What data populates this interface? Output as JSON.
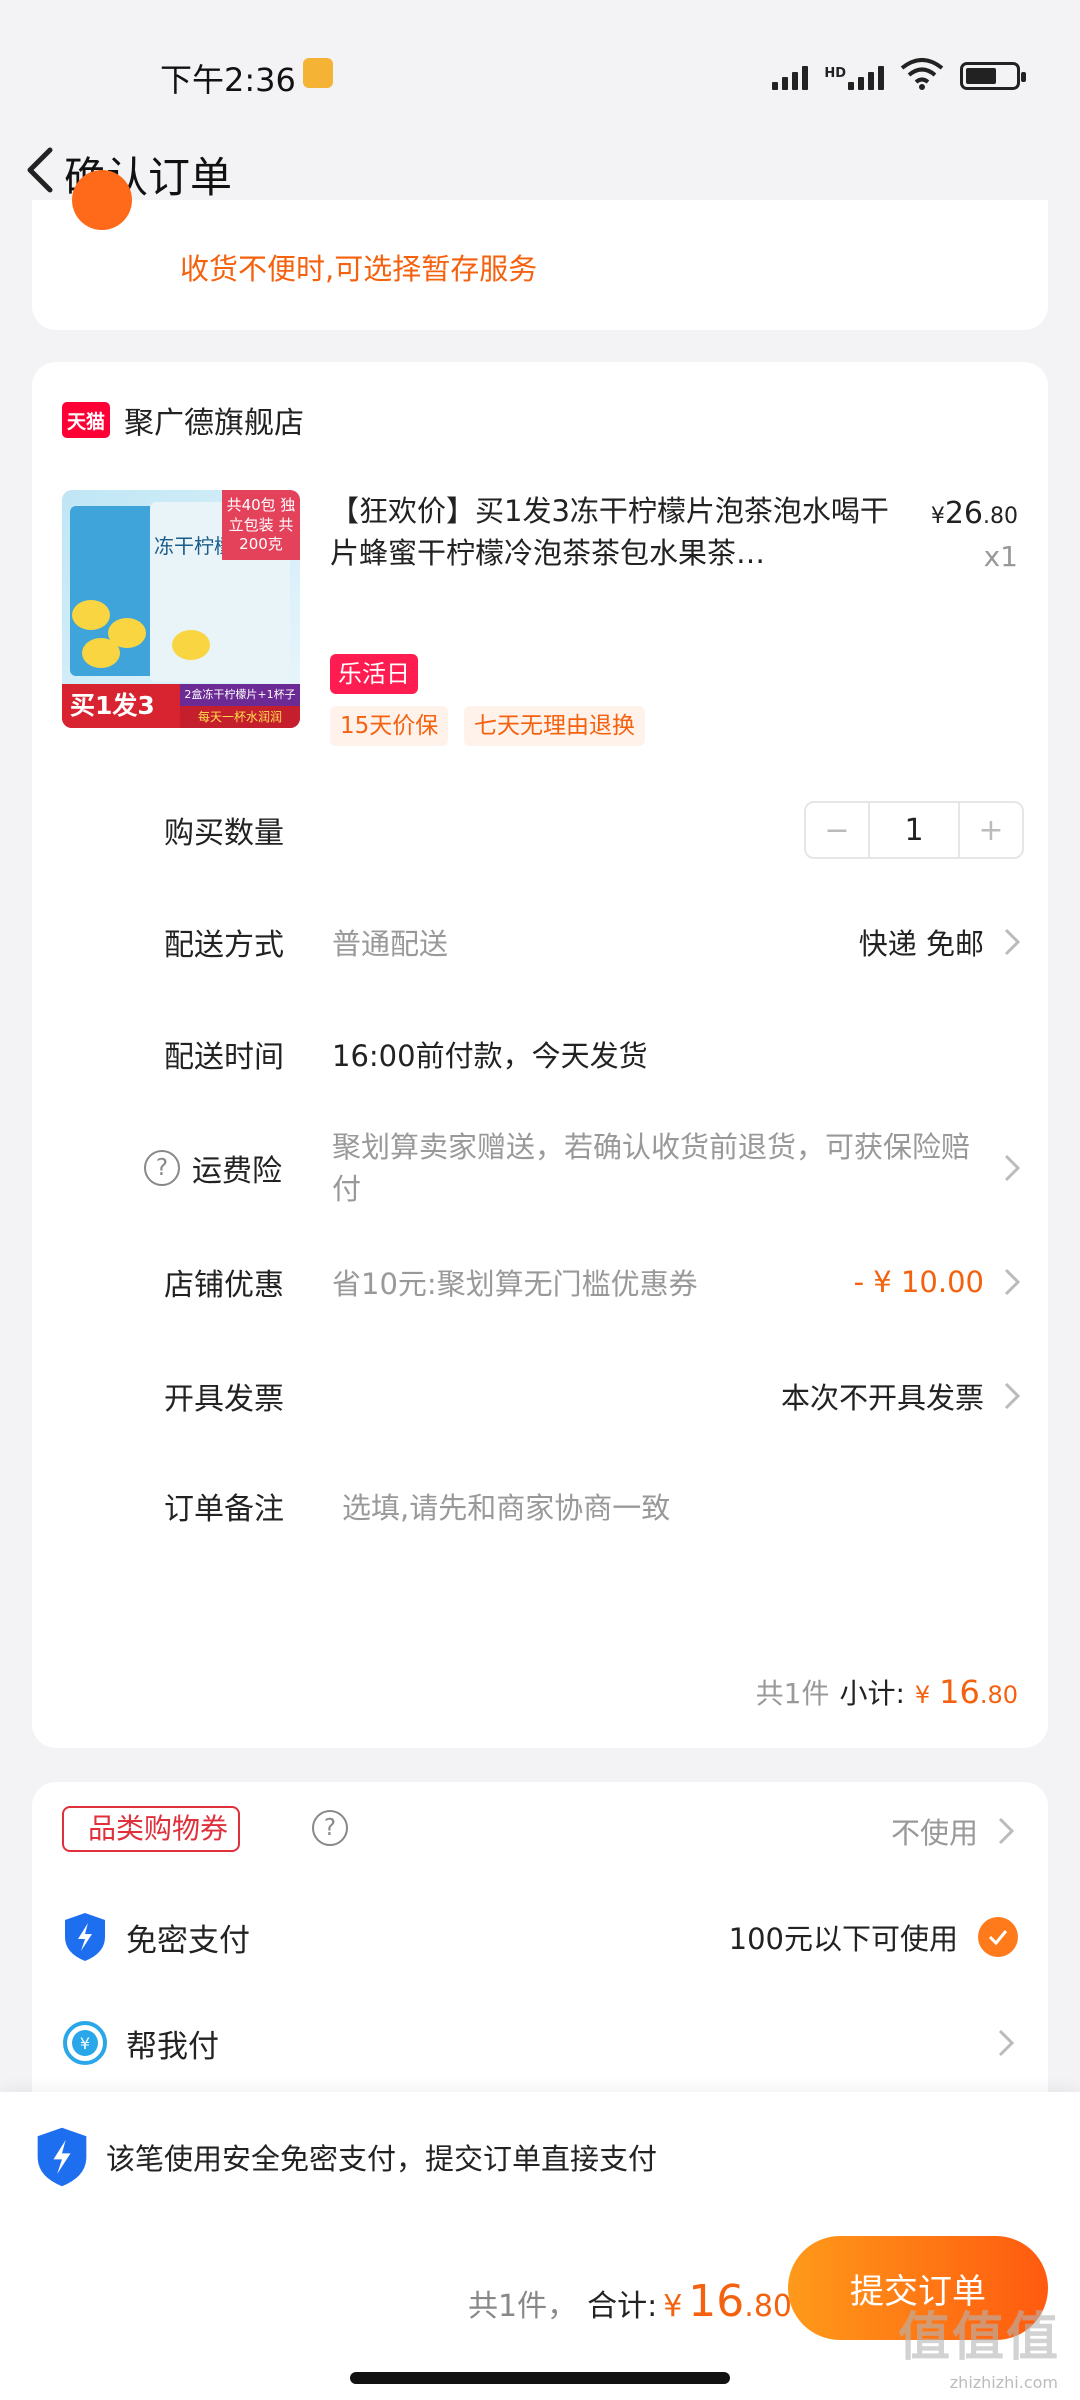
{
  "status_bar": {
    "time": "下午2:36",
    "hd_label": "HD"
  },
  "nav": {
    "title": "确认订单"
  },
  "notice": {
    "text": "收货不便时,可选择暂存服务"
  },
  "store": {
    "badge": "天猫",
    "name": "聚广德旗舰店",
    "product": {
      "title": "【狂欢价】买1发3冻干柠檬片泡茶泡水喝干片蜂蜜干柠檬冷泡茶茶包水果茶…",
      "price_currency": "¥",
      "price_int": "26",
      "price_dec": ".80",
      "quantity": "x1",
      "event_tag": "乐活日",
      "service_tags": [
        "15天价保",
        "七天无理由退换"
      ],
      "thumb_text": {
        "corner": "共40包 独立包装 共200克",
        "name": "冻干柠檬",
        "buy": "买1发3",
        "promo": "2盒冻干柠檬片+1杯子",
        "slogan": "每天一杯水润润"
      }
    },
    "rows": {
      "qty_label": "购买数量",
      "qty_minus": "−",
      "qty_value": "1",
      "qty_plus": "+",
      "ship_label": "配送方式",
      "ship_sub": "普通配送",
      "ship_val": "快递 免邮",
      "time_label": "配送时间",
      "time_val": "16:00前付款，今天发货",
      "ins_label": "运费险",
      "ins_sub": "聚划算卖家赠送，若确认收货前退货，可获保险赔付",
      "disc_label": "店铺优惠",
      "disc_sub": "省10元:聚划算无门槛优惠券",
      "disc_val": "- ¥ 10.00",
      "inv_label": "开具发票",
      "inv_val": "本次不开具发票",
      "note_label": "订单备注",
      "note_placeholder": "选填,请先和商家协商一致"
    },
    "subtotal": {
      "count": "共1件",
      "label": "小计:",
      "currency": "¥",
      "int": "16",
      "dec": ".80"
    }
  },
  "payment": {
    "coupon_label": "品类购物券",
    "coupon_val": "不使用",
    "nopwd_label": "免密支付",
    "nopwd_val": "100元以下可使用",
    "helppay_label": "帮我付"
  },
  "bottom": {
    "safe_text": "该笔使用安全免密支付，提交订单直接支付",
    "count": "共1件，",
    "total_label": "合计:",
    "currency": "¥",
    "int": "16",
    "dec": ".80",
    "submit": "提交订单",
    "watermark": "值值值",
    "watermark_sub": "zhizhizhi.com"
  },
  "colors": {
    "accent": "#f5620f",
    "tmall_red": "#ff0036",
    "event_pink": "#ff1c50"
  }
}
